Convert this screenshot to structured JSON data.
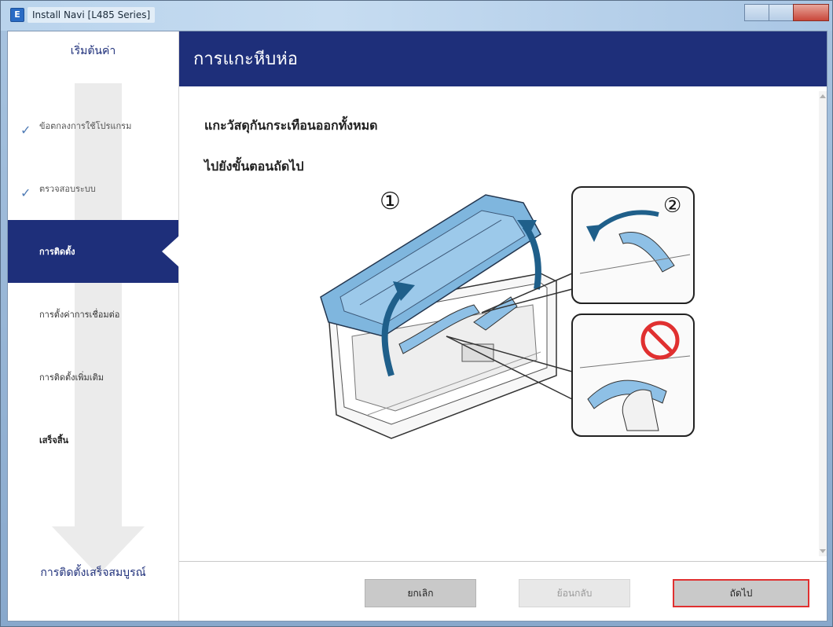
{
  "window": {
    "title": "Install Navi [L485 Series]",
    "icon": "E"
  },
  "sidebar": {
    "header": "เริ่มต้นค่า",
    "footer": "การติดตั้งเสร็จสมบูรณ์",
    "steps": [
      {
        "label": "ข้อตกลงการใช้โปรแกรม",
        "state": "done"
      },
      {
        "label": "ตรวจสอบระบบ",
        "state": "done"
      },
      {
        "label": "การติดตั้ง",
        "state": "active"
      },
      {
        "label": "การตั้งค่าการเชื่อมต่อ",
        "state": "pending"
      },
      {
        "label": "การติดตั้งเพิ่มเติม",
        "state": "pending"
      },
      {
        "label": "เสร็จสิ้น",
        "state": "pending"
      }
    ]
  },
  "main": {
    "title": "การแกะหีบห่อ",
    "instruction_1": "แกะวัสดุกันกระเทือนออกทั้งหมด",
    "instruction_2": "ไปยังขั้นตอนถัดไป",
    "figure": {
      "step_1": "①",
      "step_2": "②"
    }
  },
  "footer": {
    "cancel_label": "ยกเลิก",
    "back_label": "ย้อนกลับ",
    "next_label": "ถัดไป"
  },
  "colors": {
    "accent": "#1e2f7a",
    "illustration_blue": "#7fb6de",
    "highlight_red": "#e03030"
  }
}
